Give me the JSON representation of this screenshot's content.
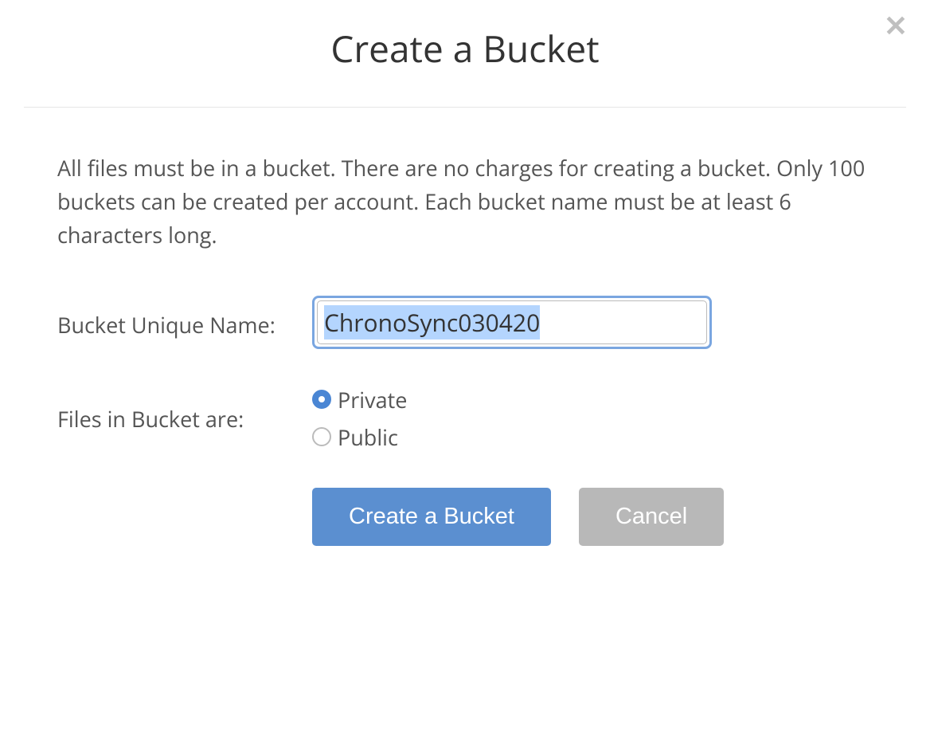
{
  "dialog": {
    "title": "Create a Bucket",
    "description": "All files must be in a bucket. There are no charges for creating a bucket. Only 100 buckets can be created per account. Each bucket name must be at least 6 characters long.",
    "nameLabel": "Bucket Unique Name:",
    "nameValue": "ChronoSync030420",
    "visibilityLabel": "Files in Bucket are:",
    "visibilityOptions": {
      "private": "Private",
      "public": "Public"
    },
    "buttons": {
      "create": "Create a Bucket",
      "cancel": "Cancel"
    }
  }
}
